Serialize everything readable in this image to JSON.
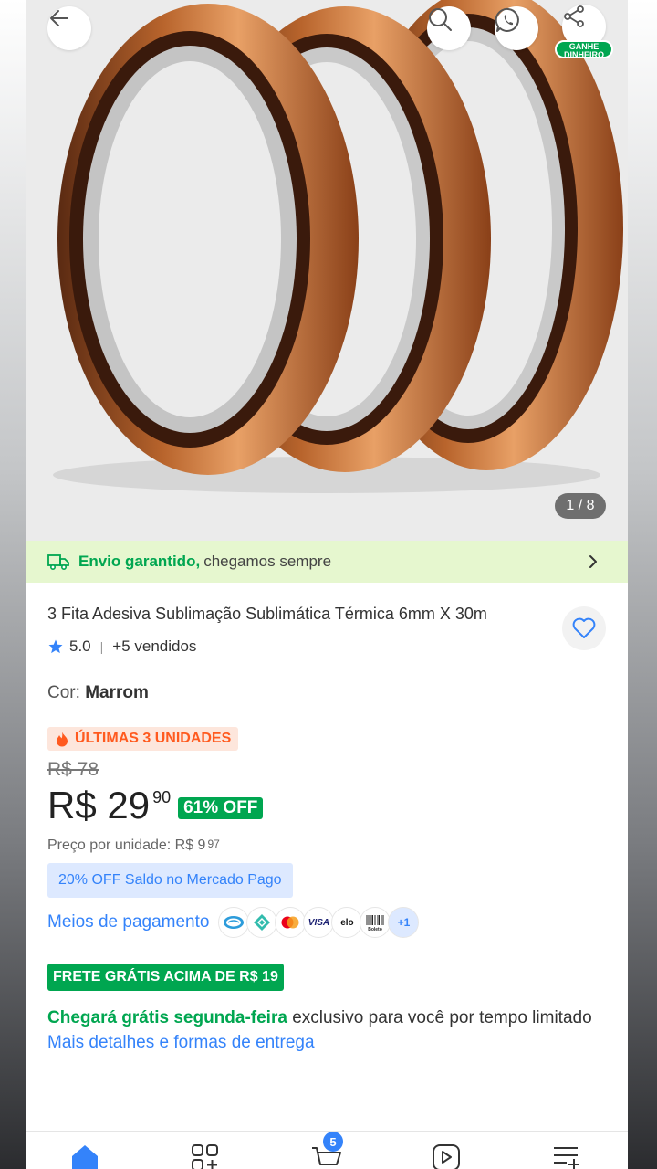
{
  "gallery": {
    "counter": "1 / 8",
    "share_badge": "GANHE DINHEIRO"
  },
  "shipping": {
    "strong": "Envio garantido,",
    "rest": "chegamos sempre"
  },
  "product": {
    "title": "3 Fita Adesiva Sublimação Sublimática Térmica 6mm X 30m",
    "rating": "5.0",
    "sold": "+5 vendidos",
    "color_label": "Cor:",
    "color_value": "Marrom",
    "stock_badge": "ÚLTIMAS 3 UNIDADES",
    "old_price": "R$ 78",
    "price_main": "R$ 29",
    "price_cents": "90",
    "discount": "61% OFF",
    "unit_price_label": "Preço por unidade: R$ 9",
    "unit_price_cents": "97",
    "mp_offer": "20% OFF Saldo no Mercado Pago",
    "payment_label": "Meios de pagamento",
    "payment_more": "+1",
    "free_shipping_badge": "FRETE GRÁTIS ACIMA DE R$ 19",
    "arrival_green": "Chegará grátis segunda-feira",
    "arrival_rest": "exclusivo para você por tempo limitado",
    "more_details": "Mais detalhes e formas de entrega"
  },
  "payment_methods": [
    "mercado-pago",
    "pix",
    "mastercard",
    "VISA",
    "elo",
    "Boleto"
  ],
  "nav": {
    "cart_count": "5"
  },
  "colors": {
    "accent": "#3483fa",
    "green": "#00a650",
    "orange": "#ff5a1f"
  }
}
